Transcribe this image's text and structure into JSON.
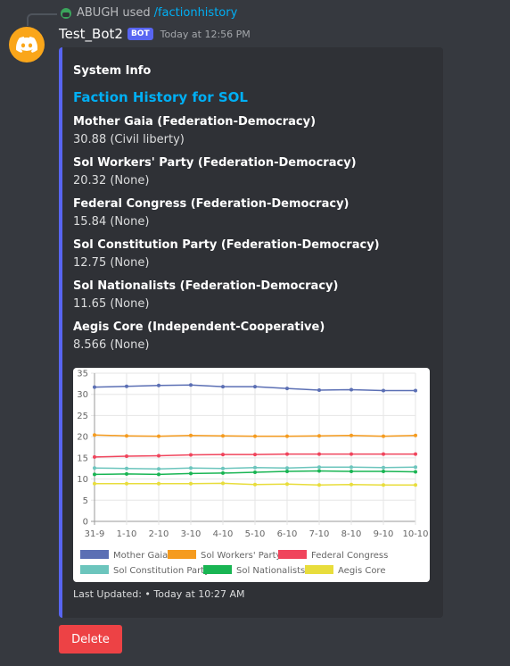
{
  "reply": {
    "user": "ABUGH",
    "used_text": "used",
    "command": "/factionhistory"
  },
  "message": {
    "username": "Test_Bot2",
    "bot_tag": "BOT",
    "timestamp": "Today at 12:56 PM"
  },
  "embed": {
    "author": "System Info",
    "title": "Faction History for SOL",
    "accent_color": "#5865f2",
    "fields": [
      {
        "name": "Mother Gaia (Federation-Democracy)",
        "value": "30.88 (Civil liberty)"
      },
      {
        "name": "Sol Workers' Party (Federation-Democracy)",
        "value": "20.32 (None)"
      },
      {
        "name": "Federal Congress (Federation-Democracy)",
        "value": "15.84 (None)"
      },
      {
        "name": "Sol Constitution Party (Federation-Democracy)",
        "value": "12.75 (None)"
      },
      {
        "name": "Sol Nationalists (Federation-Democracy)",
        "value": "11.65 (None)"
      },
      {
        "name": "Aegis Core (Independent-Cooperative)",
        "value": "8.566 (None)"
      }
    ],
    "footer": "Last Updated: • Today at 10:27 AM"
  },
  "chart_data": {
    "type": "line",
    "categories": [
      "31-9",
      "1-10",
      "2-10",
      "3-10",
      "4-10",
      "5-10",
      "6-10",
      "7-10",
      "8-10",
      "9-10",
      "10-10"
    ],
    "ylim": [
      0,
      35
    ],
    "yticks": [
      0,
      5,
      10,
      15,
      20,
      25,
      30,
      35
    ],
    "grid": true,
    "legend_position": "bottom",
    "series": [
      {
        "name": "Mother Gaia",
        "color": "#5b6fb4",
        "values": [
          31.7,
          31.9,
          32.1,
          32.2,
          31.8,
          31.8,
          31.4,
          31.0,
          31.1,
          30.9,
          30.9
        ]
      },
      {
        "name": "Sol Workers' Party",
        "color": "#f59b1e",
        "values": [
          20.4,
          20.2,
          20.1,
          20.3,
          20.2,
          20.1,
          20.1,
          20.2,
          20.3,
          20.1,
          20.3
        ]
      },
      {
        "name": "Federal Congress",
        "color": "#f0445c",
        "values": [
          15.2,
          15.4,
          15.5,
          15.7,
          15.8,
          15.8,
          15.9,
          15.9,
          15.9,
          15.9,
          15.9
        ]
      },
      {
        "name": "Sol Constitution Party",
        "color": "#6cc5bd",
        "values": [
          12.6,
          12.5,
          12.4,
          12.6,
          12.5,
          12.7,
          12.6,
          12.8,
          12.8,
          12.7,
          12.8
        ]
      },
      {
        "name": "Sol Nationalists",
        "color": "#19b553",
        "values": [
          11.1,
          11.2,
          11.1,
          11.3,
          11.4,
          11.6,
          11.8,
          11.9,
          11.8,
          11.8,
          11.7
        ]
      },
      {
        "name": "Aegis Core",
        "color": "#e8dd3c",
        "values": [
          8.9,
          8.9,
          8.9,
          8.9,
          9.0,
          8.7,
          8.8,
          8.6,
          8.7,
          8.6,
          8.6
        ]
      }
    ]
  },
  "actions": {
    "delete_label": "Delete",
    "delete_color": "#ed4245"
  }
}
